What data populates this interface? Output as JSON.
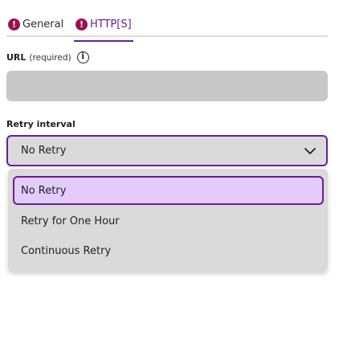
{
  "tabs": [
    {
      "label": "General",
      "status_icon": "error-icon",
      "active": false
    },
    {
      "label": "HTTP[S]",
      "status_icon": "error-icon",
      "active": true
    }
  ],
  "url_field": {
    "label": "URL",
    "required_text": "(required)",
    "info_icon": "info-icon",
    "value": "",
    "placeholder": ""
  },
  "retry": {
    "label": "Retry interval",
    "selected": "No Retry",
    "options": [
      "No Retry",
      "Retry for One Hour",
      "Continuous Retry"
    ]
  },
  "colors": {
    "accent": "#6d1b9c",
    "error": "#9c1050",
    "field_bg": "#c8c8c8",
    "select_bg": "#dadada",
    "selected_option_bg": "#e3ccfb"
  }
}
